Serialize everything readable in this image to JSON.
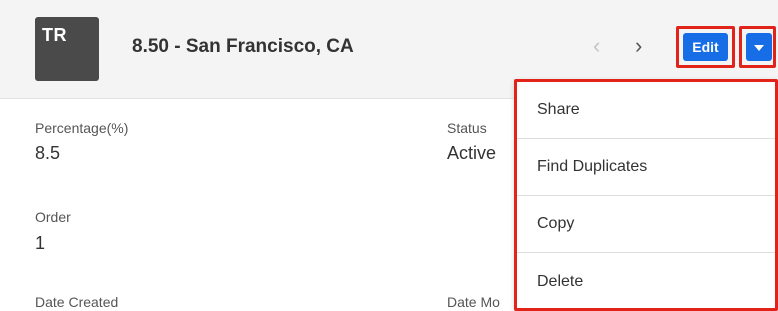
{
  "header": {
    "avatar_initials": "TR",
    "record_title": "8.50 - San Francisco, CA",
    "prev_icon": "chevron-left-icon",
    "next_icon": "chevron-right-icon",
    "edit_label": "Edit",
    "actions_caret_icon": "caret-down-icon",
    "button_color": "#176de5",
    "highlight_color": "#e2231a"
  },
  "fields": {
    "percentage_label": "Percentage(%)",
    "percentage_value": "8.5",
    "status_label": "Status",
    "status_value": "Active",
    "order_label": "Order",
    "order_value": "1",
    "date_created_label": "Date Created",
    "date_modified_label": "Date Mo"
  },
  "actions_menu": {
    "items": [
      "Share",
      "Find Duplicates",
      "Copy",
      "Delete"
    ]
  }
}
